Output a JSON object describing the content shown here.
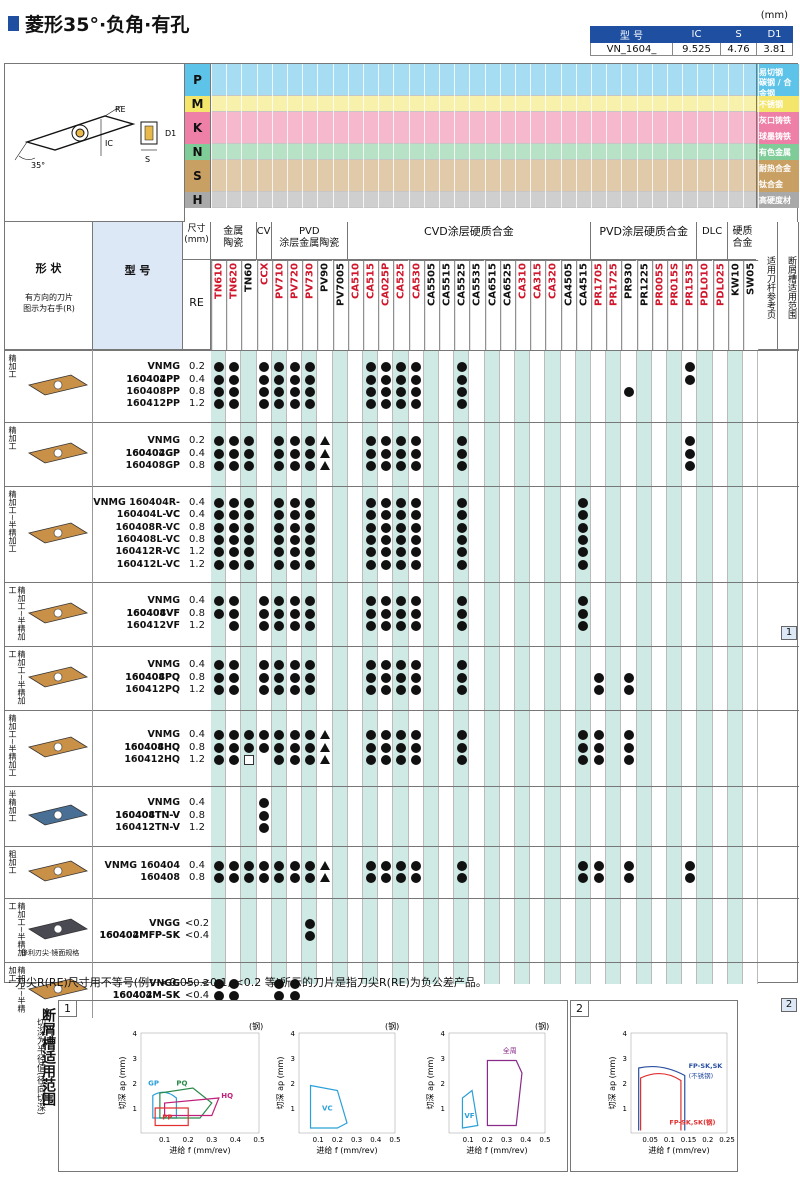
{
  "header": {
    "title": "菱形35°·负角·有孔",
    "unit": "(mm)"
  },
  "dims_table": {
    "headers": [
      "型 号",
      "IC",
      "S",
      "D1"
    ],
    "row": [
      "VN_1604_",
      "9.525",
      "4.76",
      "3.81"
    ]
  },
  "diagram_labels": {
    "re": "RE",
    "ic": "IC",
    "d1": "D1",
    "s": "S",
    "angle": "35°"
  },
  "materials": [
    {
      "key": "P",
      "color": "#5ec3e8",
      "right": [
        "易切钢",
        "碳钢 / 合金钢"
      ]
    },
    {
      "key": "M",
      "color": "#f4e66a",
      "right": [
        "不锈钢"
      ]
    },
    {
      "key": "K",
      "color": "#ee7fa6",
      "right": [
        "灰口铸铁",
        "球墨铸铁"
      ]
    },
    {
      "key": "N",
      "color": "#7fcc98",
      "right": [
        "有色金属"
      ]
    },
    {
      "key": "S",
      "color": "#c9a064",
      "right": [
        "耐热合金",
        "钛合金"
      ]
    },
    {
      "key": "H",
      "color": "#a9a9a9",
      "right": [
        "高硬度材"
      ]
    }
  ],
  "headers": {
    "shape": "形 状",
    "shape_note": "有方向的刀片\n图示为右手(R)",
    "model": "型 号",
    "size": "尺寸\n(mm)",
    "re": "RE",
    "groups": [
      "金属\n陶瓷",
      "CVD",
      "PVD\n涂层金属陶瓷",
      "CVD涂层硬质合金",
      "PVD涂层硬质合金",
      "DLC",
      "硬质\n合金"
    ],
    "ref_col": "适用刀杆参考页",
    "range_col": "断屑槽适用范围"
  },
  "grades": [
    {
      "name": "TN610",
      "color": "#d0162b"
    },
    {
      "name": "TN620",
      "color": "#d0162b"
    },
    {
      "name": "TN60",
      "color": "#111"
    },
    {
      "name": "CCX",
      "color": "#d0162b"
    },
    {
      "name": "PV710",
      "color": "#d0162b"
    },
    {
      "name": "PV720",
      "color": "#d0162b"
    },
    {
      "name": "PV730",
      "color": "#d0162b"
    },
    {
      "name": "PV90",
      "color": "#111"
    },
    {
      "name": "PV7005",
      "color": "#111"
    },
    {
      "name": "CA510",
      "color": "#d0162b"
    },
    {
      "name": "CA515",
      "color": "#d0162b"
    },
    {
      "name": "CA025P",
      "color": "#d0162b"
    },
    {
      "name": "CA525",
      "color": "#d0162b"
    },
    {
      "name": "CA530",
      "color": "#d0162b"
    },
    {
      "name": "CA5505",
      "color": "#111"
    },
    {
      "name": "CA5515",
      "color": "#111"
    },
    {
      "name": "CA5525",
      "color": "#111"
    },
    {
      "name": "CA5535",
      "color": "#111"
    },
    {
      "name": "CA6515",
      "color": "#111"
    },
    {
      "name": "CA6525",
      "color": "#111"
    },
    {
      "name": "CA310",
      "color": "#d0162b"
    },
    {
      "name": "CA315",
      "color": "#d0162b"
    },
    {
      "name": "CA320",
      "color": "#d0162b"
    },
    {
      "name": "CA4505",
      "color": "#111"
    },
    {
      "name": "CA4515",
      "color": "#111"
    },
    {
      "name": "PR1705",
      "color": "#d0162b"
    },
    {
      "name": "PR1725",
      "color": "#d0162b"
    },
    {
      "name": "PR930",
      "color": "#111"
    },
    {
      "name": "PR1225",
      "color": "#111"
    },
    {
      "name": "PR005S",
      "color": "#d0162b"
    },
    {
      "name": "PR015S",
      "color": "#d0162b"
    },
    {
      "name": "PR1535",
      "color": "#d0162b"
    },
    {
      "name": "PDL010",
      "color": "#d0162b"
    },
    {
      "name": "PDL025",
      "color": "#d0162b"
    },
    {
      "name": "KW10",
      "color": "#111"
    },
    {
      "name": "SW05",
      "color": "#111"
    }
  ],
  "rows": [
    {
      "label": "精加工",
      "insert": "gold",
      "ref": "",
      "items": [
        {
          "model": "VNMG 160402PP",
          "re": "0.2",
          "marks": "110111100111110001"
        },
        {
          "model": "160404PP",
          "re": "0.4",
          "marks": "110111100111110001"
        },
        {
          "model": "160408PP",
          "re": "0.8",
          "marks": "110111100111110010"
        },
        {
          "model": "160412PP",
          "re": "1.2",
          "marks": "110111100111110000"
        }
      ]
    },
    {
      "label": "精加工",
      "insert": "gold",
      "ref": "",
      "items": [
        {
          "model": "VNMG 160402GP",
          "re": "0.2",
          "marks": "111011120111110001"
        },
        {
          "model": "160404GP",
          "re": "0.4",
          "marks": "111011120111110001"
        },
        {
          "model": "160408GP",
          "re": "0.8",
          "marks": "111011120111110001"
        }
      ]
    },
    {
      "label": "精加工~半精加工",
      "insert": "gold",
      "ref": "",
      "items": [
        {
          "model": "VNMG 160404R-VC",
          "re": "0.4",
          "marks": "111011100111111000"
        },
        {
          "model": "160404L-VC",
          "re": "0.4",
          "marks": "111011100111111000"
        },
        {
          "model": "160408R-VC",
          "re": "0.8",
          "marks": "111011100111111000"
        },
        {
          "model": "160408L-VC",
          "re": "0.8",
          "marks": "111011100111111000"
        },
        {
          "model": "160412R-VC",
          "re": "1.2",
          "marks": "111011100111111000"
        },
        {
          "model": "160412L-VC",
          "re": "1.2",
          "marks": "111011100111111000"
        }
      ]
    },
    {
      "label": "精加工~半精加工",
      "insert": "gold",
      "ref": "1",
      "items": [
        {
          "model": "VNMG 160404VF",
          "re": "0.4",
          "marks": "110111100111111000"
        },
        {
          "model": "160408VF",
          "re": "0.8",
          "marks": "110111100111111000"
        },
        {
          "model": "160412VF",
          "re": "1.2",
          "marks": "010111100111111000"
        }
      ]
    },
    {
      "label": "精加工~半精加工",
      "insert": "gold",
      "ref": "",
      "items": [
        {
          "model": "VNMG 160404PQ",
          "re": "0.4",
          "marks": "110111100111110000"
        },
        {
          "model": "160408PQ",
          "re": "0.8",
          "marks": "110111100111110110"
        },
        {
          "model": "160412PQ",
          "re": "1.2",
          "marks": "110111100111110110"
        }
      ]
    },
    {
      "label": "精加工~半精加工",
      "insert": "gold",
      "ref": "",
      "items": [
        {
          "model": "VNMG 160404HQ",
          "re": "0.4",
          "marks": "111111120111111110"
        },
        {
          "model": "160408HQ",
          "re": "0.8",
          "marks": "111111120111111110"
        },
        {
          "model": "160412HQ",
          "re": "1.2",
          "marks": "113011120111111110"
        }
      ]
    },
    {
      "label": "半精加工",
      "insert": "blue",
      "ref": "",
      "items": [
        {
          "model": "VNMG 160404TN-V",
          "re": "0.4",
          "marks": "000100000000000000"
        },
        {
          "model": "160408TN-V",
          "re": "0.8",
          "marks": "000100000000000000"
        },
        {
          "model": "160412TN-V",
          "re": "1.2",
          "marks": "000100000000000000"
        }
      ]
    },
    {
      "label": "粗加工",
      "insert": "gold",
      "ref": "",
      "items": [
        {
          "model": "VNMG 160404",
          "re": "0.4",
          "marks": "111111120111111111"
        },
        {
          "model": "160408",
          "re": "0.8",
          "marks": "111111120111111111"
        }
      ]
    },
    {
      "label": "精加工~半精加工",
      "sub": "锋利刃尖·镜面规格",
      "insert": "dark",
      "ref": "",
      "items": [
        {
          "model": "VNGG 160402MFP-SK",
          "re": "<0.2",
          "marks": "000000100000000000"
        },
        {
          "model": "160404MFP-SK",
          "re": "<0.4",
          "marks": "000000100000000000"
        }
      ]
    },
    {
      "label": "精加工~半精加工",
      "insert": "gold",
      "ref": "2",
      "items": [
        {
          "model": "VNGG 160402M-SK",
          "re": "<0.2",
          "marks": "110011000000000000"
        },
        {
          "model": "160404M-SK",
          "re": "<0.4",
          "marks": "110011000000000000"
        }
      ]
    }
  ],
  "note": "· 刀尖R(RE)尺寸用不等号(例：<0.05, <0.1, <0.2 等)所示的刀片是指刀尖R(RE)为负公差产品。",
  "bottom": {
    "title": "断屑槽适用范围",
    "subtitle": "切深为半径值(径向切深)",
    "panel1": "1",
    "panel2": "2",
    "steel": "(钢)",
    "ylabel": "切深 ap (mm)",
    "xlabel": "进给 f (mm/rev)",
    "chart_data": [
      {
        "type": "area",
        "title": "(钢)",
        "xlim": [
          0,
          0.5
        ],
        "ylim": [
          0,
          4
        ],
        "series": [
          {
            "name": "GP"
          },
          {
            "name": "PQ"
          },
          {
            "name": "HQ"
          },
          {
            "name": "PP"
          }
        ]
      },
      {
        "type": "area",
        "title": "(钢)",
        "xlim": [
          0,
          0.5
        ],
        "ylim": [
          0,
          4
        ],
        "series": [
          {
            "name": "VC"
          }
        ]
      },
      {
        "type": "area",
        "title": "(钢)",
        "xlim": [
          0,
          0.5
        ],
        "ylim": [
          0,
          4
        ],
        "series": [
          {
            "name": "VF"
          },
          {
            "name": "全周"
          }
        ]
      },
      {
        "type": "area",
        "xlim": [
          0,
          0.25
        ],
        "ylim": [
          0,
          4
        ],
        "series": [
          {
            "name": "FP-SK,SK\n(不锈钢)"
          },
          {
            "name": "FP-SK,SK(钢)"
          }
        ]
      }
    ]
  },
  "symbols": {
    "dot": "●",
    "tri": "▲",
    "sq": "□"
  }
}
